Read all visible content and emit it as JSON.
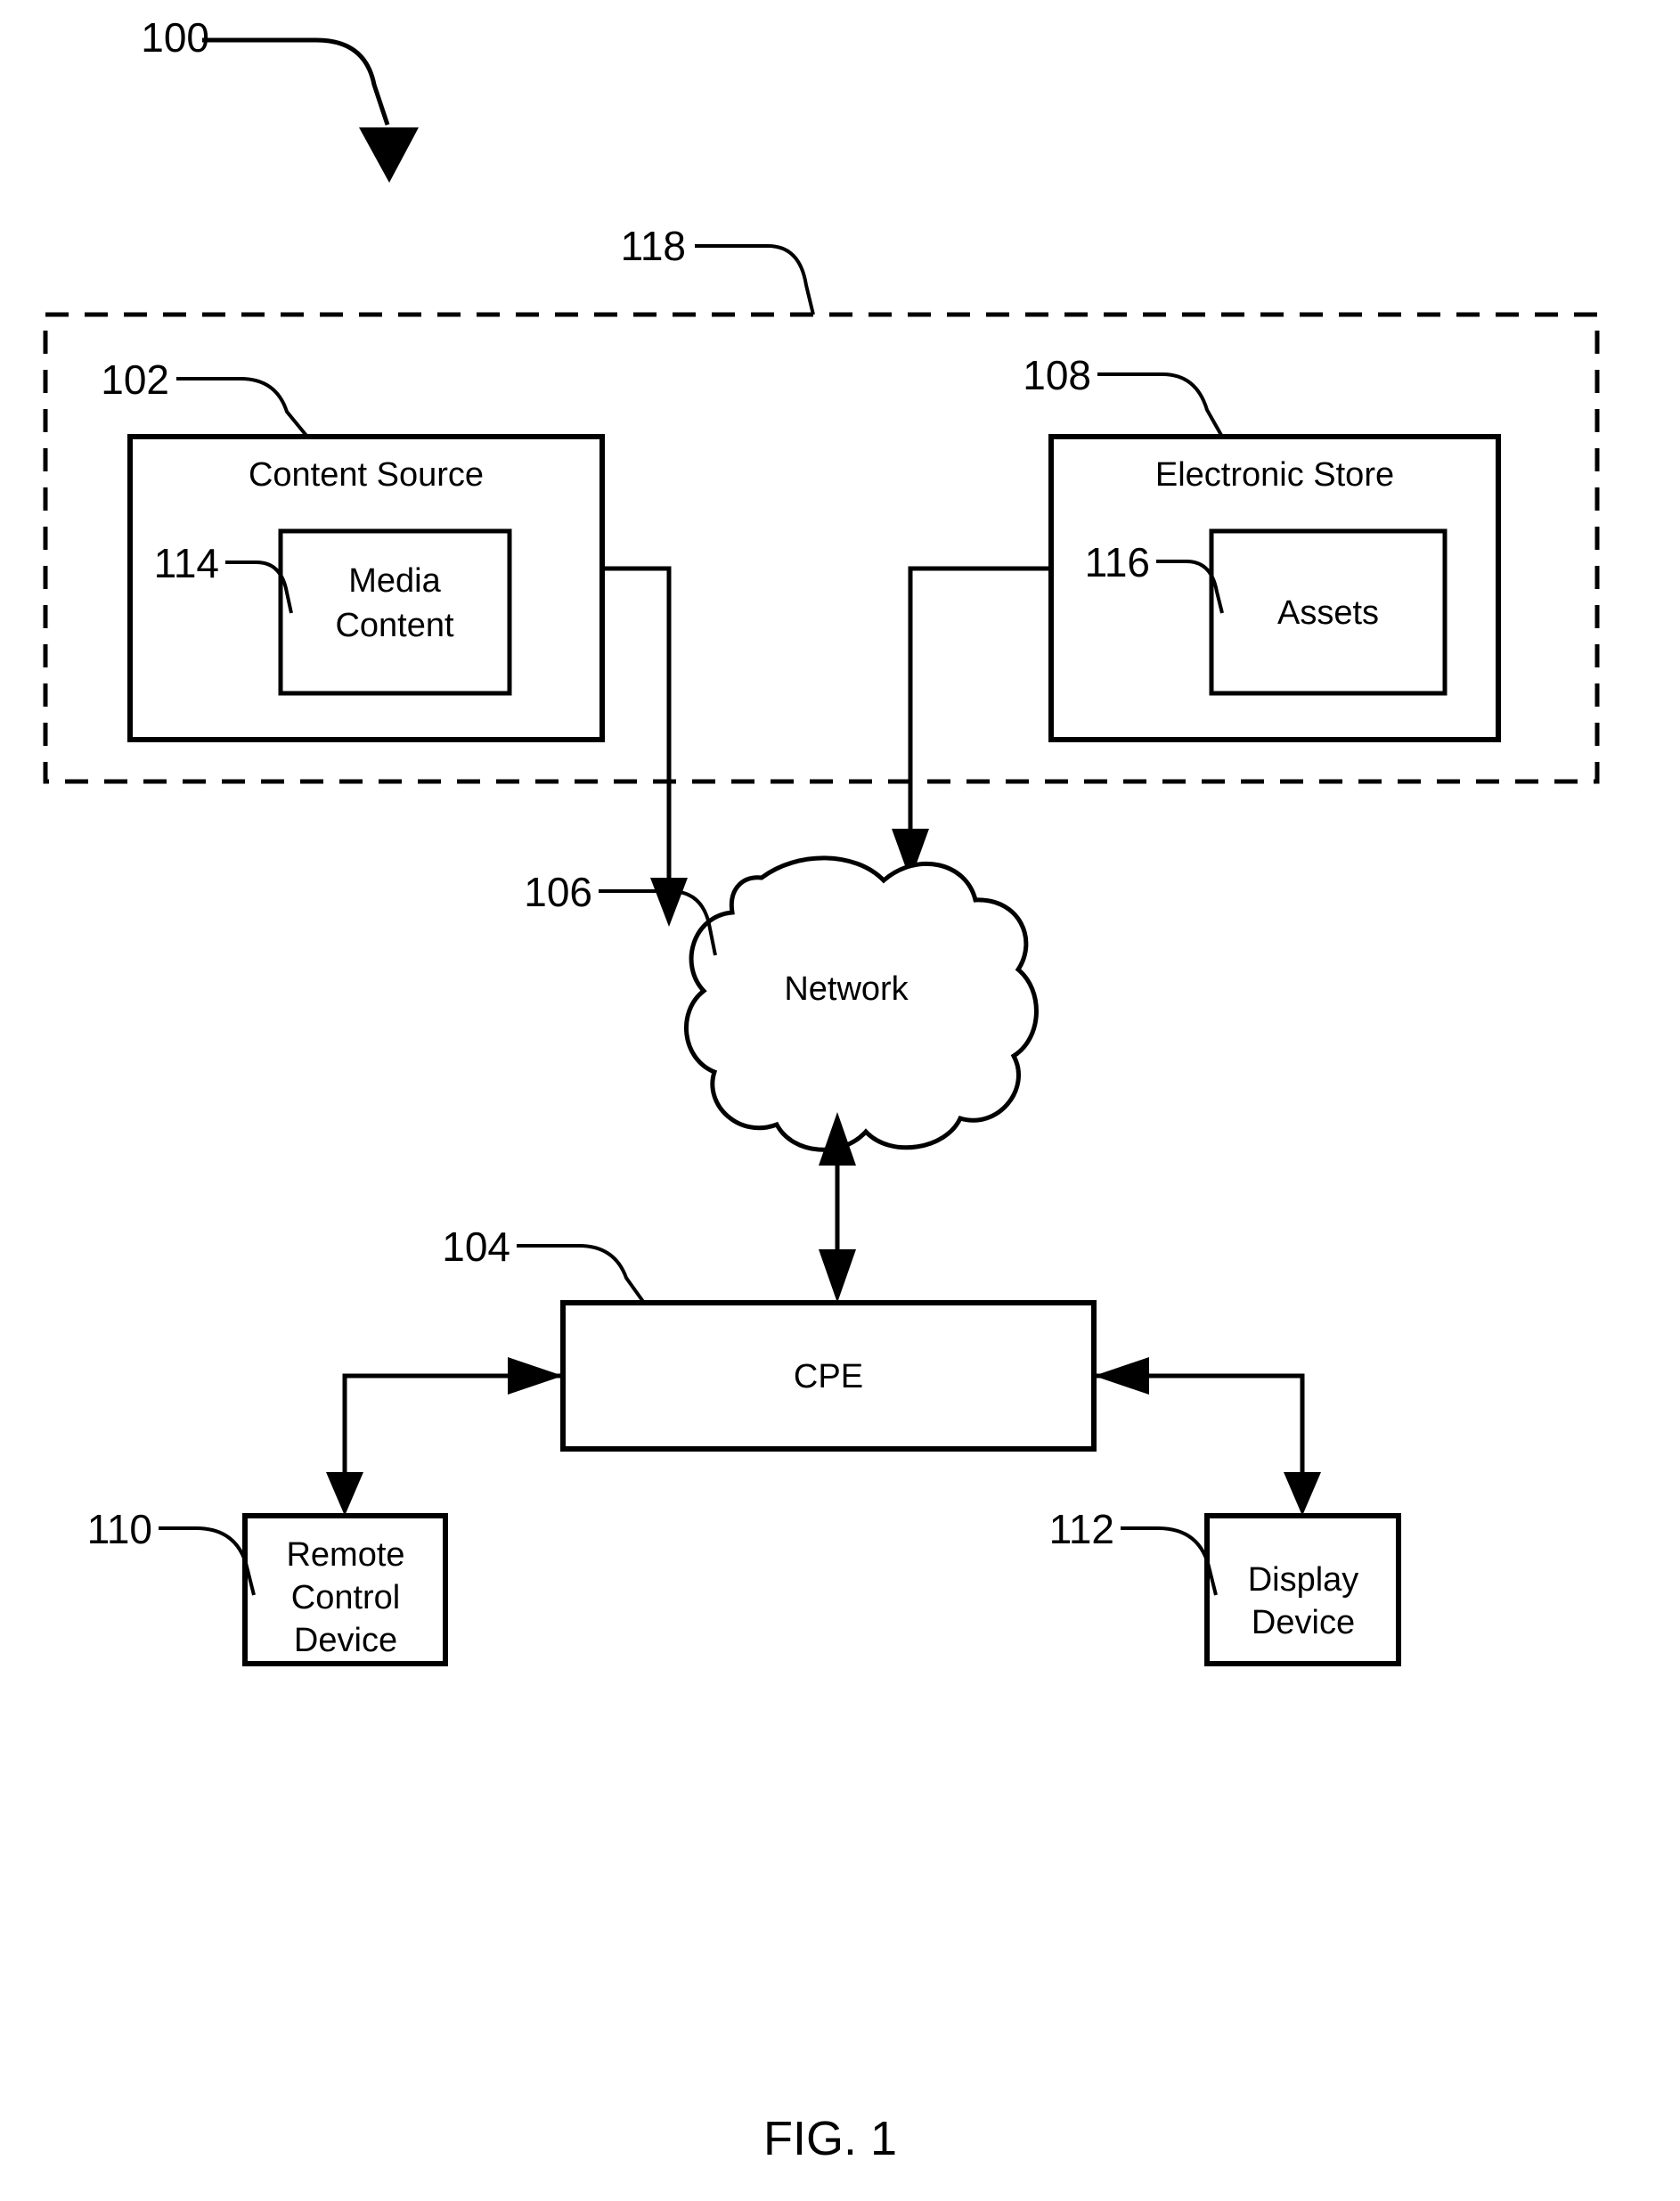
{
  "figure": {
    "caption": "FIG. 1",
    "system_ref": "100"
  },
  "group_boundary": {
    "ref": "118",
    "style": "dashed-rectangle"
  },
  "blocks": [
    {
      "id": "content-source",
      "label": "Content Source",
      "ref": "102"
    },
    {
      "id": "media-content",
      "label_line1": "Media",
      "label_line2": "Content",
      "ref": "114"
    },
    {
      "id": "electronic-store",
      "label": "Electronic Store",
      "ref": "108"
    },
    {
      "id": "assets",
      "label": "Assets",
      "ref": "116"
    },
    {
      "id": "network",
      "label": "Network",
      "ref": "106"
    },
    {
      "id": "cpe",
      "label": "CPE",
      "ref": "104"
    },
    {
      "id": "remote-control-device",
      "label_line1": "Remote",
      "label_line2": "Control",
      "label_line3": "Device",
      "ref": "110"
    },
    {
      "id": "display-device",
      "label_line1": "Display",
      "label_line2": "Device",
      "ref": "112"
    }
  ],
  "colors": {
    "ink": "#000000",
    "paper": "#ffffff"
  }
}
